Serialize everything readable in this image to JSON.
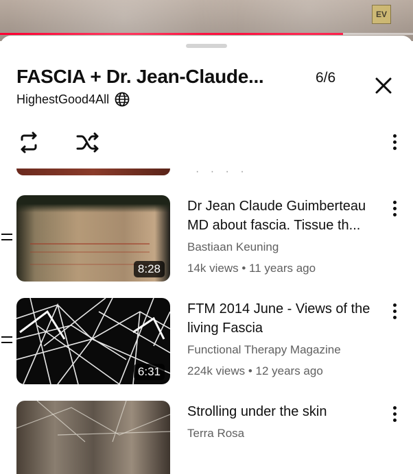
{
  "video": {
    "badge": "EV",
    "progress": 0.83
  },
  "playlist": {
    "title": "FASCIA + Dr. Jean-Claude...",
    "counter": "6/6",
    "channel": "HighestGood4All"
  },
  "items": [
    {
      "title": "Dr Jean Claude Guimberteau MD about fascia. Tissue th...",
      "channel": "Bastiaan Keuning",
      "meta": "14k views • 11 years ago",
      "duration": "8:28"
    },
    {
      "title": "FTM 2014 June - Views of the living Fascia",
      "channel": "Functional Therapy Magazine",
      "meta": "224k views • 12 years ago",
      "duration": "6:31"
    },
    {
      "title": "Strolling under the skin",
      "channel": "Terra Rosa",
      "meta": "",
      "duration": ""
    }
  ],
  "icons": {
    "close": "close-icon",
    "loop": "loop-icon",
    "shuffle": "shuffle-icon",
    "globe": "globe-icon",
    "more": "more-vert-icon",
    "drag": "drag-handle-icon"
  }
}
